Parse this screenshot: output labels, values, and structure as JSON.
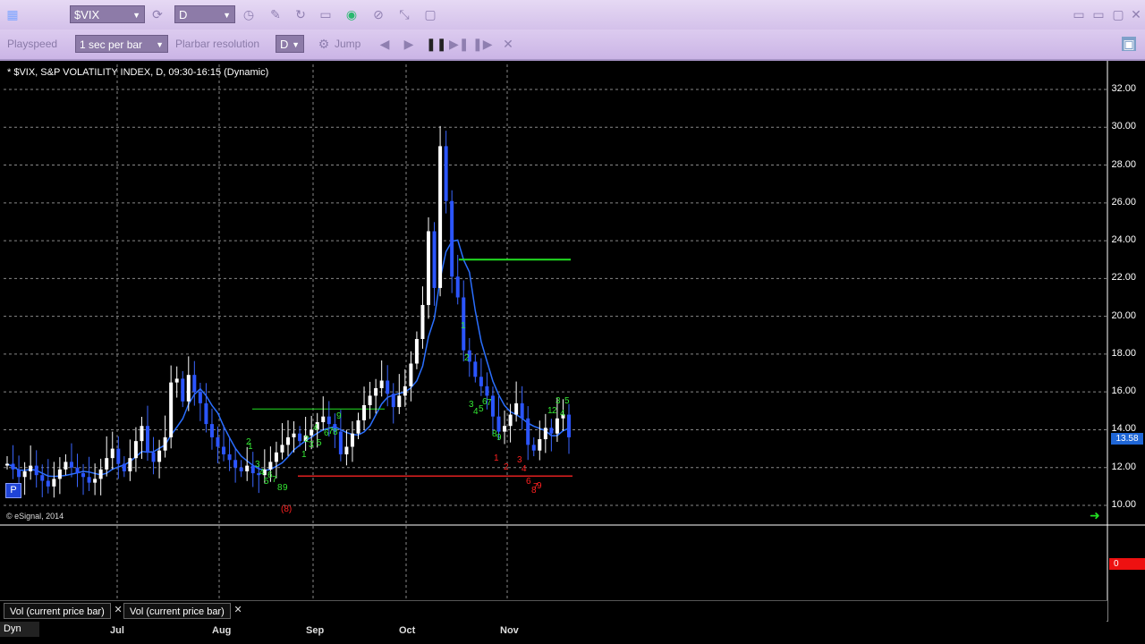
{
  "toolbar": {
    "symbol": "$VIX",
    "interval": "D",
    "playspeed_label": "Playspeed",
    "playspeed_value": "1 sec per bar",
    "bar_res_label": "Plarbar resolution",
    "bar_res_value": "D",
    "jump_label": "Jump"
  },
  "chart": {
    "title": "* $VIX, S&P VOLATILITY INDEX, D, 09:30-16:15 (Dynamic)",
    "copyright": "© eSignal, 2014",
    "last_price": "13.58",
    "volume_value": "0",
    "p_button": "P"
  },
  "tabs": [
    {
      "label": "Vol (current price bar)"
    },
    {
      "label": "Vol (current price bar)"
    }
  ],
  "footer": {
    "dyn_label": "Dyn"
  },
  "chart_data": {
    "type": "candlestick",
    "y_ticks": [
      "32.00",
      "30.00",
      "28.00",
      "26.00",
      "24.00",
      "22.00",
      "20.00",
      "18.00",
      "16.00",
      "14.00",
      "12.00",
      "10.00"
    ],
    "x_ticks": [
      "Jul",
      "Aug",
      "Sep",
      "Oct",
      "Nov"
    ],
    "ylim": [
      10,
      32
    ],
    "closes": [
      12.2,
      11.9,
      11.5,
      11.8,
      12.1,
      11.6,
      11.3,
      11.0,
      11.4,
      11.9,
      12.3,
      12.0,
      11.7,
      11.5,
      11.2,
      11.4,
      11.9,
      12.5,
      13.0,
      12.2,
      11.8,
      12.5,
      13.4,
      14.2,
      12.8,
      12.3,
      12.9,
      13.6,
      16.5,
      16.7,
      15.5,
      16.9,
      16.0,
      15.4,
      14.3,
      13.6,
      13.1,
      12.7,
      12.4,
      12.0,
      11.8,
      12.1,
      11.7,
      11.6,
      11.9,
      12.3,
      12.8,
      13.2,
      13.6,
      13.8,
      13.4,
      13.7,
      14.0,
      14.4,
      14.7,
      14.3,
      13.9,
      12.7,
      13.1,
      13.8,
      14.5,
      15.3,
      15.8,
      16.2,
      16.6,
      15.9,
      15.2,
      15.8,
      16.3,
      17.5,
      18.8,
      20.6,
      24.5,
      21.5,
      29.0,
      26.1,
      22.1,
      21.0,
      18.2,
      17.6,
      16.8,
      16.3,
      15.8,
      14.7,
      13.9,
      14.2,
      14.8,
      15.4,
      14.6,
      13.2,
      12.9,
      13.5,
      14.1,
      13.8,
      14.6,
      14.8,
      13.6
    ],
    "moving_average_color": "#2a6fff",
    "resistance_green": 23.0,
    "support_red": 11.55,
    "support_green": 15.1,
    "indicator_colors": {
      "setup_green": "#33e833",
      "countdown_red": "#ff2020"
    }
  }
}
